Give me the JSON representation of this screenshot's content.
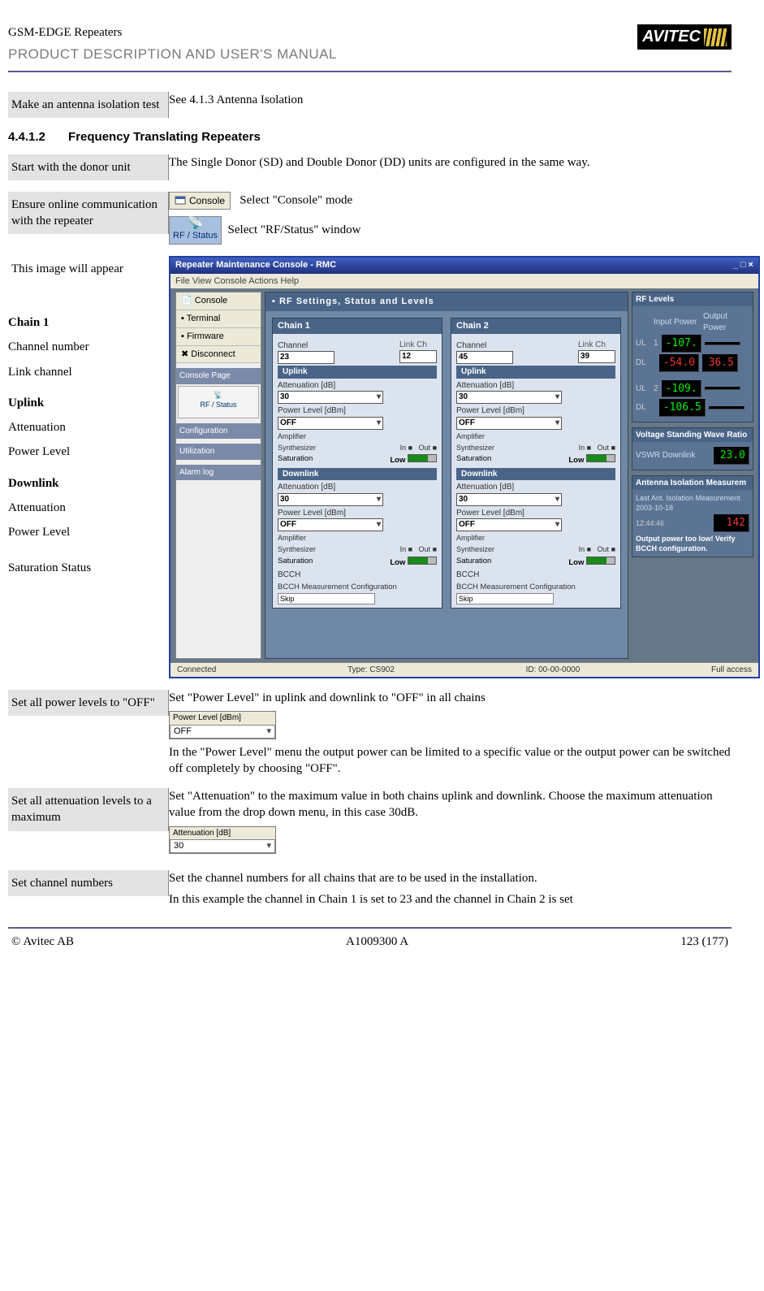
{
  "header": {
    "product_line": "GSM-EDGE Repeaters",
    "doc_title": "PRODUCT DESCRIPTION AND USER'S MANUAL",
    "brand": "AVITEC"
  },
  "rows": {
    "antenna_test": {
      "left": "Make an antenna isolation test",
      "right": "See 4.1.3 Antenna Isolation"
    },
    "section": {
      "num": "4.4.1.2",
      "title": "Frequency Translating Repeaters"
    },
    "start_donor": {
      "left": "Start with the donor unit",
      "right": "The Single Donor (SD) and Double Donor (DD) units are configured in the same way."
    },
    "ensure_online": {
      "left": "Ensure online communication with the repeater",
      "console_btn": "Console",
      "console_txt": "Select \"Console\" mode",
      "rf_btn": "RF / Status",
      "rf_txt": "Select \"RF/Status\" window"
    },
    "image_appear": {
      "left": "This image will appear"
    },
    "labels": {
      "chain1": "Chain 1",
      "channel_number": "Channel number",
      "link_channel": "Link channel",
      "uplink": "Uplink",
      "attenuation": "Attenuation",
      "power_level": "Power Level",
      "downlink": "Downlink",
      "attenuation2": "Attenuation",
      "power_level2": "Power Level",
      "saturation": "Saturation Status"
    },
    "set_power": {
      "left": "Set all power levels to \"OFF\"",
      "p1": "Set \"Power Level\" in uplink and downlink to \"OFF\" in all chains",
      "field_label": "Power Level [dBm]",
      "field_value": "OFF",
      "p2": "In the \"Power Level\" menu the output power can be limited to a specific value or the output power can be switched off completely by choosing \"OFF\"."
    },
    "set_atten": {
      "left": "Set all attenuation levels to a maximum",
      "p1": "Set \"Attenuation\" to the maximum value in both chains uplink and downlink. Choose the maximum attenuation value from the drop down menu, in this case 30dB.",
      "field_label": "Attenuation [dB]",
      "field_value": "30"
    },
    "set_channels": {
      "left": "Set channel numbers",
      "p1": "Set the channel numbers for all chains that are to be used in the installation.",
      "p2": "In this example the channel in Chain 1 is set to 23 and the channel in Chain 2 is set"
    }
  },
  "screenshot": {
    "title": "Repeater Maintenance Console - RMC",
    "win_ctrl": "_ □ ×",
    "menu": "File   View   Console   Actions   Help",
    "left_items": {
      "console": "Console",
      "terminal": "Terminal",
      "firmware": "Firmware",
      "disconnect": "Disconnect"
    },
    "left_sects": {
      "console_page": "Console Page",
      "config": "Configuration",
      "util": "Utilization",
      "alarm": "Alarm log"
    },
    "main_title": "RF Settings, Status and Levels",
    "chain1": {
      "h": "Chain 1",
      "chlbl": "Channel",
      "ch": "23",
      "linklbl": "Link Ch",
      "link": "12",
      "uplink": "Uplink",
      "att_lbl": "Attenuation [dB]",
      "att": "30",
      "pl_lbl": "Power Level [dBm]",
      "pl": "OFF",
      "amp": "Amplifier",
      "synth": "Synthesizer",
      "in": "In",
      "out": "Out",
      "sat": "Saturation",
      "low": "Low",
      "downlink": "Downlink",
      "att2": "30",
      "pl2": "OFF",
      "bcch": "BCCH",
      "bcch_cfg": "BCCH Measurement Configuration",
      "skip": "Skip"
    },
    "chain2": {
      "h": "Chain 2",
      "chlbl": "Channel",
      "ch": "45",
      "linklbl": "Link Ch",
      "link": "39",
      "att": "30",
      "pl": "OFF",
      "att2": "30",
      "pl2": "OFF"
    },
    "right": {
      "rflevels": "RF Levels",
      "ip": "Input Power",
      "op": "Output Power",
      "ul": "UL",
      "dl": "DL",
      "v_ul1_ip": "-107.",
      "v_ul1_op": "",
      "v_dl1_ip": "-54.0",
      "v_dl1_op": "36.5",
      "v_ul2_ip": "-109.",
      "v_ul2_op": "",
      "v_dl2_ip": "-106.5",
      "v_dl2_op": "",
      "vswr_h": "Voltage Standing Wave Ratio",
      "vswr_l": "VSWR Downlink",
      "vswr_v": "23.0",
      "ant_h": "Antenna Isolation Measurem",
      "ant_l1": "Last Ant. Isolation Measurement",
      "ant_l2": "2003-10-18",
      "ant_l3": "12:44:46",
      "ant_v": "142",
      "ant_note": "Output power too low! Verify BCCH configuration."
    },
    "status": {
      "left": "Connected",
      "mid1": "Type: CS902",
      "mid2": "ID: 00-00-0000",
      "right": "Full access"
    }
  },
  "footer": {
    "copyright": "© Avitec AB",
    "docnum": "A1009300 A",
    "page": "123 (177)"
  }
}
